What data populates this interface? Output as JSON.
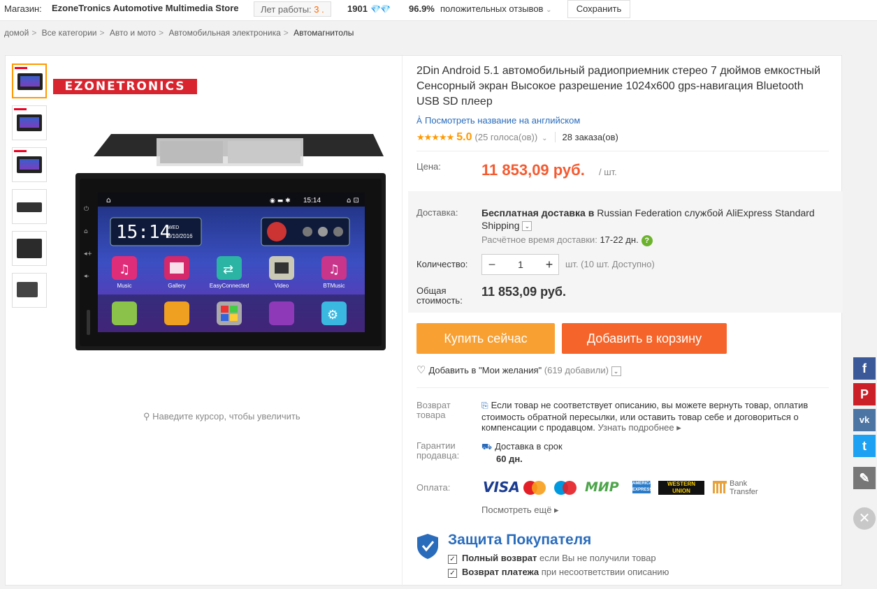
{
  "topbar": {
    "store_label": "Магазин:",
    "store_name": "EzoneTronics Automotive Multimedia Store",
    "years_label": "Лет работы:",
    "years_value": "3 .",
    "score": "1901",
    "diamonds": "💎💎",
    "positive_pct": "96.9%",
    "positive_label": "положительных отзывов",
    "save_label": "Сохранить"
  },
  "breadcrumbs": [
    "домой",
    "Все категории",
    "Авто и мото",
    "Автомобильная электроника",
    "Автомагнитолы"
  ],
  "gallery": {
    "brand": "EZONETRONICS",
    "zoom_hint": "Наведите курсор, чтобы увеличить",
    "screen_time": "15:14",
    "screen_date": "8/10/2016",
    "screen_day": "WED",
    "status_time": "15:14",
    "apps_row1": [
      "Music",
      "Gallery",
      "EasyConnected",
      "Video",
      "BTMusic"
    ]
  },
  "product": {
    "title": "2Din Android 5.1 автомобильный радиоприемник стерео 7 дюймов емкостный Сенсорный экран Высокое разрешение 1024x600 gps-навигация Bluetooth USB SD плеер",
    "translate_link": "Посмотреть название на английском",
    "stars": "★★★★★",
    "rating": "5.0",
    "votes": "(25 голоса(ов))",
    "orders": "28 заказа(ов)",
    "price_label": "Цена:",
    "price": "11 853,09 руб.",
    "per_unit": "/ шт."
  },
  "delivery": {
    "label": "Доставка:",
    "text_bold": "Бесплатная доставка в",
    "text_rest": " Russian Federation службой AliExpress Standard Shipping",
    "eta_label": "Расчётное время доставки:",
    "eta_value": "17-22 дн."
  },
  "quantity": {
    "label": "Количество:",
    "value": "1",
    "available": "шт. (10 шт. Доступно)"
  },
  "total": {
    "label": "Общая стоимость:",
    "value": "11 853,09 руб."
  },
  "actions": {
    "buy_now": "Купить сейчас",
    "add_to_cart": "Добавить в корзину",
    "wishlist": "Добавить в \"Мои желания\"",
    "wishlist_count": "(619 добавили)"
  },
  "returns": {
    "label": "Возврат товара",
    "text": "Если товар не соответствует описанию, вы можете вернуть товар, оплатив стоимость обратной пересылки, или оставить товар себе и договориться о компенсации с продавцом.",
    "more": "Узнать подробнее"
  },
  "guarantee": {
    "label": "Гарантии продавца:",
    "text": "Доставка в срок",
    "days": "60 дн."
  },
  "payment": {
    "label": "Оплата:",
    "visa": "VISA",
    "mir": "МИР",
    "amex": "AMERICAN EXPRESS",
    "wu": "WESTERN UNION",
    "bank": "Bank Transfer",
    "more": "Посмотреть ещё"
  },
  "protection": {
    "title": "Защита Покупателя",
    "row1_bold": "Полный возврат",
    "row1_rest": " если Вы не получили товар",
    "row2_bold": "Возврат платежа",
    "row2_rest": " при несоответствии описанию"
  },
  "social": [
    "f",
    "P",
    "vk",
    "t",
    "✎"
  ],
  "colors": {
    "price": "#f45a30",
    "buy": "#f8a032",
    "cart": "#f5642a",
    "link": "#2a6cbc",
    "star": "#ff9900"
  }
}
